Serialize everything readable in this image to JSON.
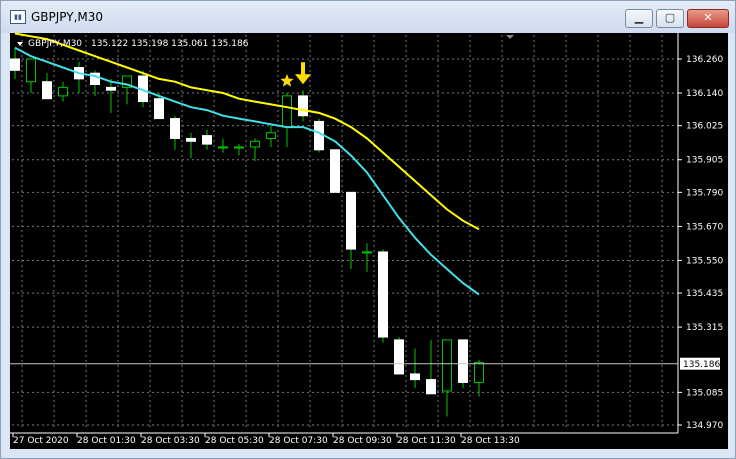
{
  "window": {
    "title": "GBPJPY,M30",
    "icon": "chart-window-icon",
    "buttons": {
      "minimize": "▁",
      "maximize": "▢",
      "close": "✕"
    }
  },
  "chart_header": {
    "symbol": "GBPJPY,M30",
    "ohlc": "135.122 135.198 135.061 135.186"
  },
  "colors": {
    "background": "#000000",
    "grid": "#7a7a7a",
    "bull_body": "#000000",
    "bear_body": "#ffffff",
    "wick": "#00c800",
    "ma_fast": "#40e0e8",
    "ma_slow": "#ffff00",
    "arrow": "#ffdd00",
    "star": "#ffdd00"
  },
  "chart_data": {
    "type": "candlestick",
    "y_ticks": [
      "136.260",
      "136.140",
      "136.025",
      "135.905",
      "135.790",
      "135.670",
      "135.550",
      "135.435",
      "135.315",
      "135.085",
      "134.970"
    ],
    "current_price": "135.186",
    "x_ticks": [
      "27 Oct 2020",
      "28 Oct 01:30",
      "28 Oct 03:30",
      "28 Oct 05:30",
      "28 Oct 07:30",
      "28 Oct 09:30",
      "28 Oct 11:30",
      "28 Oct 13:30"
    ],
    "ylim": [
      134.97,
      136.26
    ],
    "candles": [
      {
        "o": 136.26,
        "h": 136.3,
        "l": 136.19,
        "c": 136.22
      },
      {
        "o": 136.18,
        "h": 136.26,
        "l": 136.14,
        "c": 136.26
      },
      {
        "o": 136.18,
        "h": 136.21,
        "l": 136.12,
        "c": 136.12
      },
      {
        "o": 136.13,
        "h": 136.18,
        "l": 136.11,
        "c": 136.16
      },
      {
        "o": 136.23,
        "h": 136.25,
        "l": 136.14,
        "c": 136.19
      },
      {
        "o": 136.21,
        "h": 136.22,
        "l": 136.13,
        "c": 136.17
      },
      {
        "o": 136.16,
        "h": 136.19,
        "l": 136.07,
        "c": 136.15
      },
      {
        "o": 136.16,
        "h": 136.2,
        "l": 136.1,
        "c": 136.2
      },
      {
        "o": 136.2,
        "h": 136.22,
        "l": 136.09,
        "c": 136.11
      },
      {
        "o": 136.12,
        "h": 136.14,
        "l": 136.05,
        "c": 136.05
      },
      {
        "o": 136.05,
        "h": 136.06,
        "l": 135.94,
        "c": 135.98
      },
      {
        "o": 135.98,
        "h": 136.0,
        "l": 135.91,
        "c": 135.97
      },
      {
        "o": 135.99,
        "h": 136.01,
        "l": 135.94,
        "c": 135.96
      },
      {
        "o": 135.95,
        "h": 135.98,
        "l": 135.93,
        "c": 135.95
      },
      {
        "o": 135.95,
        "h": 135.96,
        "l": 135.92,
        "c": 135.95
      },
      {
        "o": 135.95,
        "h": 135.98,
        "l": 135.9,
        "c": 135.97
      },
      {
        "o": 135.98,
        "h": 136.03,
        "l": 135.95,
        "c": 136.0
      },
      {
        "o": 136.02,
        "h": 136.14,
        "l": 135.95,
        "c": 136.13
      },
      {
        "o": 136.13,
        "h": 136.15,
        "l": 136.04,
        "c": 136.06
      },
      {
        "o": 136.04,
        "h": 136.05,
        "l": 135.93,
        "c": 135.94
      },
      {
        "o": 135.94,
        "h": 135.94,
        "l": 135.79,
        "c": 135.79
      },
      {
        "o": 135.79,
        "h": 135.79,
        "l": 135.52,
        "c": 135.59
      },
      {
        "o": 135.58,
        "h": 135.61,
        "l": 135.51,
        "c": 135.58
      },
      {
        "o": 135.58,
        "h": 135.59,
        "l": 135.26,
        "c": 135.28
      },
      {
        "o": 135.27,
        "h": 135.28,
        "l": 135.15,
        "c": 135.15
      },
      {
        "o": 135.15,
        "h": 135.24,
        "l": 135.1,
        "c": 135.13
      },
      {
        "o": 135.13,
        "h": 135.27,
        "l": 135.09,
        "c": 135.08
      },
      {
        "o": 135.09,
        "h": 135.27,
        "l": 135.0,
        "c": 135.27
      },
      {
        "o": 135.27,
        "h": 135.27,
        "l": 135.1,
        "c": 135.12
      },
      {
        "o": 135.12,
        "h": 135.2,
        "l": 135.07,
        "c": 135.19
      }
    ],
    "ma_fast": [
      136.3,
      136.27,
      136.25,
      136.23,
      136.21,
      136.2,
      136.18,
      136.17,
      136.15,
      136.13,
      136.11,
      136.09,
      136.08,
      136.06,
      136.05,
      136.04,
      136.03,
      136.02,
      136.02,
      136.0,
      135.97,
      135.92,
      135.86,
      135.78,
      135.7,
      135.63,
      135.57,
      135.52,
      135.47,
      135.43
    ],
    "ma_slow": [
      136.35,
      136.34,
      136.33,
      136.31,
      136.29,
      136.27,
      136.25,
      136.23,
      136.21,
      136.19,
      136.18,
      136.16,
      136.15,
      136.14,
      136.12,
      136.11,
      136.1,
      136.09,
      136.08,
      136.07,
      136.05,
      136.02,
      135.98,
      135.93,
      135.88,
      135.83,
      135.78,
      135.73,
      135.69,
      135.66
    ],
    "signal_star_index": 17,
    "signal_arrow_index": 18
  }
}
